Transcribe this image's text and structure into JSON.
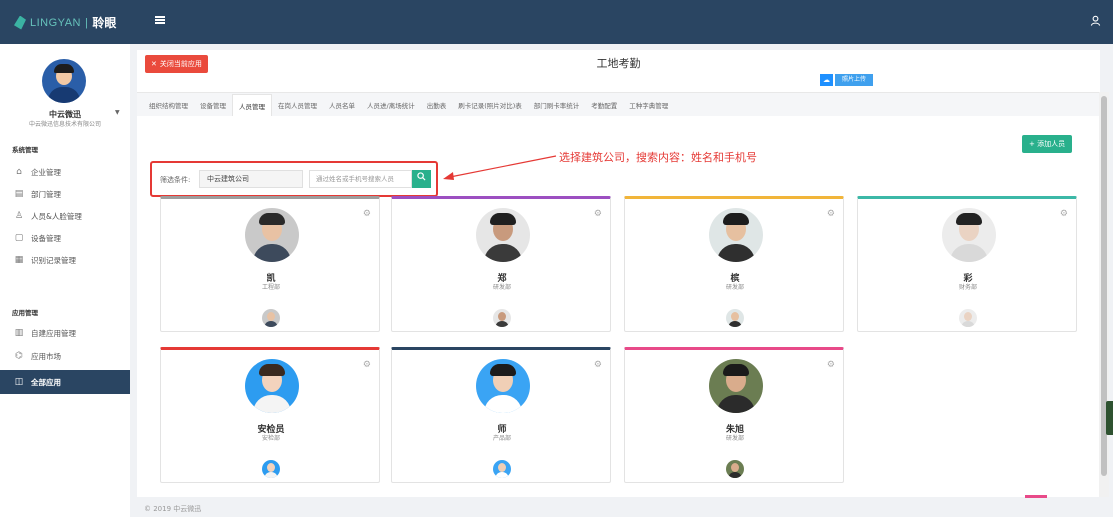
{
  "app": {
    "brand_latin": "LINGYAN",
    "brand_separator": "|",
    "brand_cn": "聆眼"
  },
  "header": {
    "menu_icon": "hamburger-icon",
    "user_icon": "user-icon"
  },
  "sidebar": {
    "user_name": "中云微迅",
    "company": "中云微迅信息技术有限公司",
    "groups": [
      {
        "title": "系统管理",
        "items": [
          {
            "label": "企业管理",
            "icon": "home-icon"
          },
          {
            "label": "部门管理",
            "icon": "department-icon"
          },
          {
            "label": "人员&人脸管理",
            "icon": "person-icon"
          },
          {
            "label": "设备管理",
            "icon": "device-icon"
          },
          {
            "label": "识别记录管理",
            "icon": "record-icon"
          }
        ]
      },
      {
        "title": "应用管理",
        "items": [
          {
            "label": "自建应用管理",
            "icon": "grid-icon"
          },
          {
            "label": "应用市场",
            "icon": "market-icon"
          },
          {
            "label": "全部应用",
            "icon": "apps-icon",
            "active": true
          }
        ]
      }
    ]
  },
  "main": {
    "close_button": "关闭当前应用",
    "title": "工地考勤",
    "upload_button": "照片上传",
    "tabs": [
      "组织结构管理",
      "设备管理",
      "人员管理",
      "在岗人员管理",
      "人员名单",
      "人员进/离场统计",
      "出勤表",
      "刷卡记录(照片对比)表",
      "部门刷卡率统计",
      "考勤配置",
      "工种字典管理"
    ],
    "active_tab": "人员管理",
    "add_button": "+ 添加人员",
    "filter": {
      "label": "筛选条件:",
      "company": "中云建筑公司",
      "search_placeholder": "通过姓名或手机号搜索人员"
    },
    "annotation": "选择建筑公司，搜索内容：姓名和手机号",
    "cards": [
      {
        "name": "凯",
        "dept": "工程部",
        "accent": "#9e9e9e",
        "skin": "#e8c2a4",
        "hair": "#2a2a2a",
        "bg": "#c9c9c9",
        "cloth": "#3d4a5c"
      },
      {
        "name": "郑",
        "dept": "研发部",
        "accent": "#9c4fc1",
        "skin": "#c89a7d",
        "hair": "#1f1f1f",
        "bg": "#e6e6e6",
        "cloth": "#3a3a3a"
      },
      {
        "name": "槟",
        "dept": "研发部",
        "accent": "#f1b53a",
        "skin": "#e6c0a0",
        "hair": "#1d1d1d",
        "bg": "#dfe6e6",
        "cloth": "#2f2f2f"
      },
      {
        "name": "彩",
        "dept": "财务部",
        "accent": "#3cb8a7",
        "skin": "#ead3c3",
        "hair": "#222222",
        "bg": "#ececec",
        "cloth": "#d9d9d9"
      },
      {
        "name": "安检员",
        "dept": "安检部",
        "accent": "#e53935",
        "skin": "#f3d3bd",
        "hair": "#3a2a20",
        "bg": "#2d9cf0",
        "cloth": "#f4f4f4"
      },
      {
        "name": "师",
        "dept": "产品部",
        "accent": "#2a4562",
        "skin": "#f0cfb6",
        "hair": "#1c1c1c",
        "bg": "#3aa4f4",
        "cloth": "#ffffff"
      },
      {
        "name": "朱旭",
        "dept": "研发部",
        "accent": "#e84a89",
        "skin": "#d9ac8c",
        "hair": "#1a1a1a",
        "bg": "#6b7d52",
        "cloth": "#2b2b2b"
      }
    ]
  },
  "footer": "© 2019 中云微迅"
}
